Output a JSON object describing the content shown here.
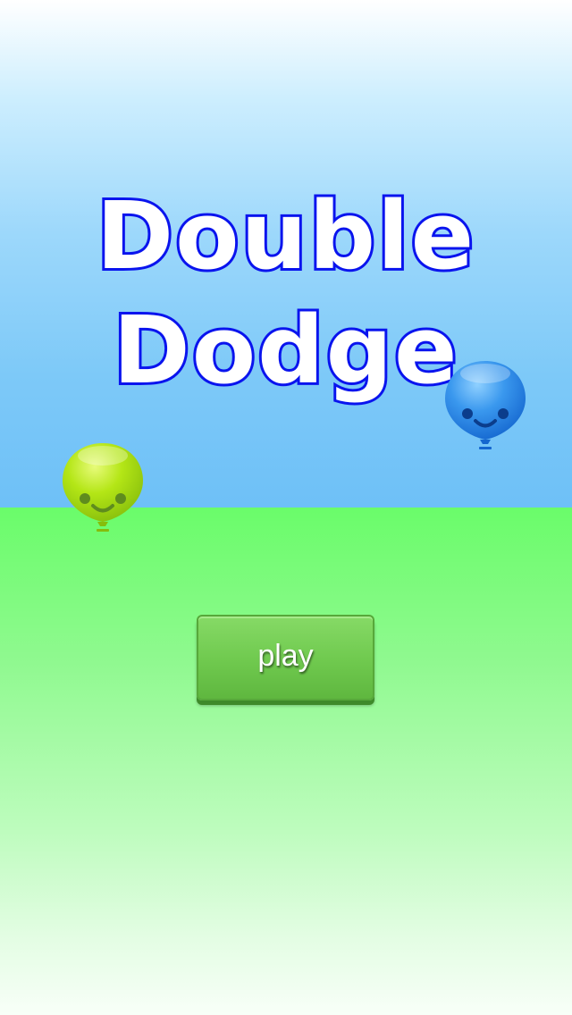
{
  "game": {
    "title_line1": "Double",
    "title_line2": "Dodge",
    "play_label": "play"
  },
  "colors": {
    "title_fill": "#ffffff",
    "title_outline": "#0a14ee",
    "sky": "#7dc9f8",
    "ground": "#6afc6a",
    "button": "#6fc94e",
    "balloon_green": "#b4e616",
    "balloon_blue": "#3a98ee"
  },
  "icons": {
    "balloon_left": "smiling-green-balloon",
    "balloon_right": "smiling-blue-balloon"
  }
}
